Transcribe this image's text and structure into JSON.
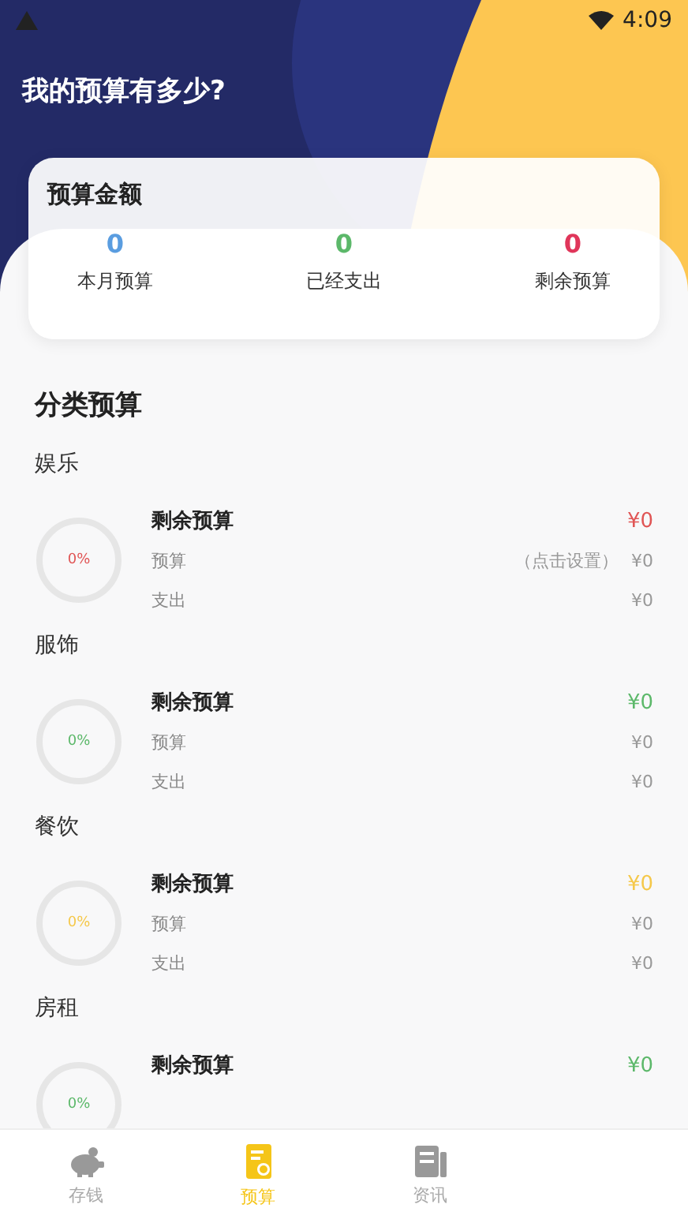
{
  "status_bar": {
    "time": "4:09"
  },
  "header": {
    "title": "我的预算有多少?"
  },
  "summary": {
    "title": "预算金额",
    "stats": [
      {
        "value": "0",
        "label": "本月预算",
        "color": "#5a9de0"
      },
      {
        "value": "0",
        "label": "已经支出",
        "color": "#5cb86a"
      },
      {
        "value": "0",
        "label": "剩余预算",
        "color": "#e0365a"
      }
    ]
  },
  "section_title": "分类预算",
  "categories": [
    {
      "name": "娱乐",
      "color": "#e05555",
      "percent": "0%",
      "level": 0,
      "remaining_label": "剩余预算",
      "remaining": "¥0",
      "rows": [
        {
          "label": "预算",
          "hint": "（点击设置）",
          "value": "¥0"
        },
        {
          "label": "支出",
          "value": "¥0"
        }
      ]
    },
    {
      "name": "服饰",
      "color": "#5cb86a",
      "percent": "0%",
      "level": 0,
      "remaining_label": "剩余预算",
      "remaining": "¥0",
      "rows": [
        {
          "label": "预算",
          "value": "¥0"
        },
        {
          "label": "支出",
          "value": "¥0"
        }
      ]
    },
    {
      "name": "餐饮",
      "color": "#f5c84a",
      "percent": "0%",
      "level": 0,
      "remaining_label": "剩余预算",
      "remaining": "¥0",
      "rows": [
        {
          "label": "预算",
          "value": "¥0"
        },
        {
          "label": "支出",
          "value": "¥0"
        }
      ]
    },
    {
      "name": "房租",
      "color": "#5cb86a",
      "percent": "0%",
      "level": 0,
      "remaining_label": "剩余预算",
      "remaining": "¥0"
    }
  ],
  "nav": [
    {
      "label": "存钱",
      "kind": "piggy",
      "selected": false
    },
    {
      "label": "预算",
      "kind": "budget",
      "selected": true
    },
    {
      "label": "资讯",
      "kind": "news",
      "selected": false
    }
  ]
}
